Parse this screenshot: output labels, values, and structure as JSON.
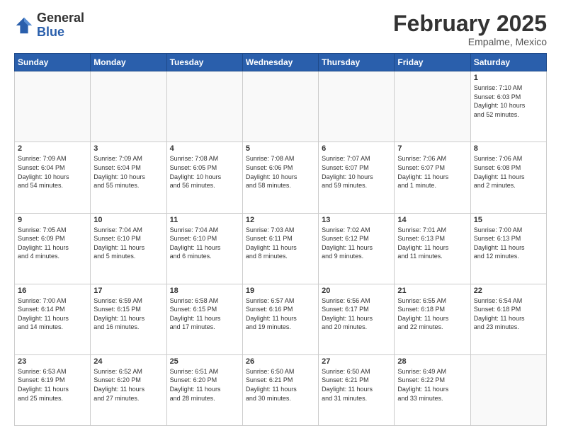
{
  "header": {
    "logo_line1": "General",
    "logo_line2": "Blue",
    "month_title": "February 2025",
    "subtitle": "Empalme, Mexico"
  },
  "days_of_week": [
    "Sunday",
    "Monday",
    "Tuesday",
    "Wednesday",
    "Thursday",
    "Friday",
    "Saturday"
  ],
  "weeks": [
    [
      {
        "day": "",
        "info": ""
      },
      {
        "day": "",
        "info": ""
      },
      {
        "day": "",
        "info": ""
      },
      {
        "day": "",
        "info": ""
      },
      {
        "day": "",
        "info": ""
      },
      {
        "day": "",
        "info": ""
      },
      {
        "day": "1",
        "info": "Sunrise: 7:10 AM\nSunset: 6:03 PM\nDaylight: 10 hours\nand 52 minutes."
      }
    ],
    [
      {
        "day": "2",
        "info": "Sunrise: 7:09 AM\nSunset: 6:04 PM\nDaylight: 10 hours\nand 54 minutes."
      },
      {
        "day": "3",
        "info": "Sunrise: 7:09 AM\nSunset: 6:04 PM\nDaylight: 10 hours\nand 55 minutes."
      },
      {
        "day": "4",
        "info": "Sunrise: 7:08 AM\nSunset: 6:05 PM\nDaylight: 10 hours\nand 56 minutes."
      },
      {
        "day": "5",
        "info": "Sunrise: 7:08 AM\nSunset: 6:06 PM\nDaylight: 10 hours\nand 58 minutes."
      },
      {
        "day": "6",
        "info": "Sunrise: 7:07 AM\nSunset: 6:07 PM\nDaylight: 10 hours\nand 59 minutes."
      },
      {
        "day": "7",
        "info": "Sunrise: 7:06 AM\nSunset: 6:07 PM\nDaylight: 11 hours\nand 1 minute."
      },
      {
        "day": "8",
        "info": "Sunrise: 7:06 AM\nSunset: 6:08 PM\nDaylight: 11 hours\nand 2 minutes."
      }
    ],
    [
      {
        "day": "9",
        "info": "Sunrise: 7:05 AM\nSunset: 6:09 PM\nDaylight: 11 hours\nand 4 minutes."
      },
      {
        "day": "10",
        "info": "Sunrise: 7:04 AM\nSunset: 6:10 PM\nDaylight: 11 hours\nand 5 minutes."
      },
      {
        "day": "11",
        "info": "Sunrise: 7:04 AM\nSunset: 6:10 PM\nDaylight: 11 hours\nand 6 minutes."
      },
      {
        "day": "12",
        "info": "Sunrise: 7:03 AM\nSunset: 6:11 PM\nDaylight: 11 hours\nand 8 minutes."
      },
      {
        "day": "13",
        "info": "Sunrise: 7:02 AM\nSunset: 6:12 PM\nDaylight: 11 hours\nand 9 minutes."
      },
      {
        "day": "14",
        "info": "Sunrise: 7:01 AM\nSunset: 6:13 PM\nDaylight: 11 hours\nand 11 minutes."
      },
      {
        "day": "15",
        "info": "Sunrise: 7:00 AM\nSunset: 6:13 PM\nDaylight: 11 hours\nand 12 minutes."
      }
    ],
    [
      {
        "day": "16",
        "info": "Sunrise: 7:00 AM\nSunset: 6:14 PM\nDaylight: 11 hours\nand 14 minutes."
      },
      {
        "day": "17",
        "info": "Sunrise: 6:59 AM\nSunset: 6:15 PM\nDaylight: 11 hours\nand 16 minutes."
      },
      {
        "day": "18",
        "info": "Sunrise: 6:58 AM\nSunset: 6:15 PM\nDaylight: 11 hours\nand 17 minutes."
      },
      {
        "day": "19",
        "info": "Sunrise: 6:57 AM\nSunset: 6:16 PM\nDaylight: 11 hours\nand 19 minutes."
      },
      {
        "day": "20",
        "info": "Sunrise: 6:56 AM\nSunset: 6:17 PM\nDaylight: 11 hours\nand 20 minutes."
      },
      {
        "day": "21",
        "info": "Sunrise: 6:55 AM\nSunset: 6:18 PM\nDaylight: 11 hours\nand 22 minutes."
      },
      {
        "day": "22",
        "info": "Sunrise: 6:54 AM\nSunset: 6:18 PM\nDaylight: 11 hours\nand 23 minutes."
      }
    ],
    [
      {
        "day": "23",
        "info": "Sunrise: 6:53 AM\nSunset: 6:19 PM\nDaylight: 11 hours\nand 25 minutes."
      },
      {
        "day": "24",
        "info": "Sunrise: 6:52 AM\nSunset: 6:20 PM\nDaylight: 11 hours\nand 27 minutes."
      },
      {
        "day": "25",
        "info": "Sunrise: 6:51 AM\nSunset: 6:20 PM\nDaylight: 11 hours\nand 28 minutes."
      },
      {
        "day": "26",
        "info": "Sunrise: 6:50 AM\nSunset: 6:21 PM\nDaylight: 11 hours\nand 30 minutes."
      },
      {
        "day": "27",
        "info": "Sunrise: 6:50 AM\nSunset: 6:21 PM\nDaylight: 11 hours\nand 31 minutes."
      },
      {
        "day": "28",
        "info": "Sunrise: 6:49 AM\nSunset: 6:22 PM\nDaylight: 11 hours\nand 33 minutes."
      },
      {
        "day": "",
        "info": ""
      }
    ]
  ]
}
